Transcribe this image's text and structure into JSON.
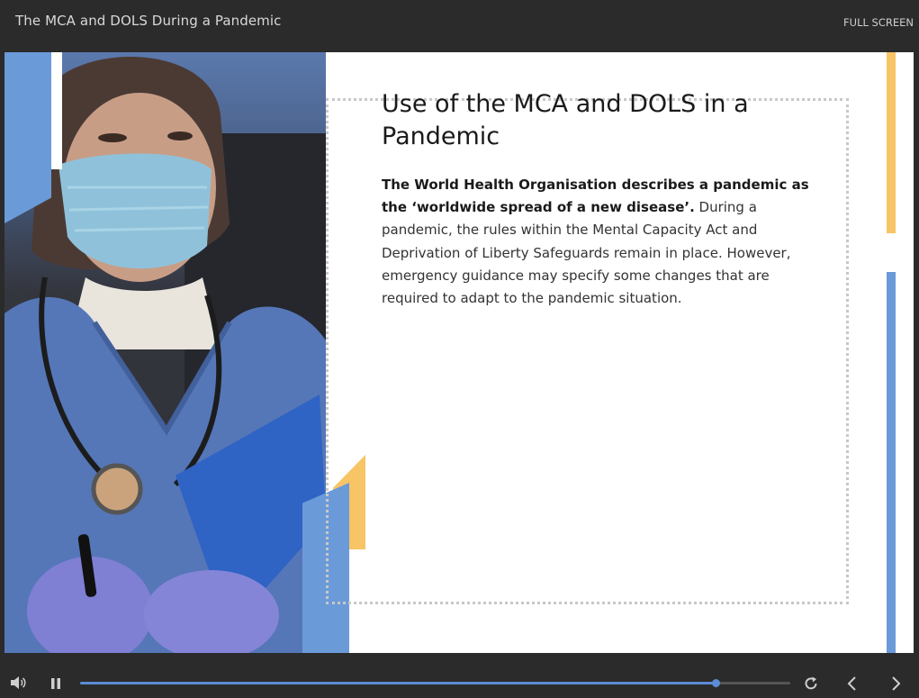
{
  "header": {
    "course_title": "The MCA and DOLS During a Pandemic",
    "fullscreen_label": "FULL SCREEN"
  },
  "slide": {
    "heading": "Use of the MCA and DOLS in a Pandemic",
    "body_bold": "The World Health Organisation describes a pandemic as the ‘worldwide spread of a new disease’.",
    "body_rest": " During a pandemic, the rules within the Mental Capacity Act and Deprivation of Liberty Safeguards remain in place. However, emergency guidance may specify some changes that are required to adapt to the pandemic situation."
  },
  "player": {
    "progress_fraction": 0.895,
    "icons": {
      "volume": "volume-icon",
      "pause": "pause-icon",
      "replay": "replay-icon",
      "prev": "chevron-left-icon",
      "next": "chevron-right-icon"
    }
  },
  "colors": {
    "accent_blue": "#6b9ad9",
    "accent_yellow": "#f7c466",
    "progress": "#5b8cd6"
  }
}
